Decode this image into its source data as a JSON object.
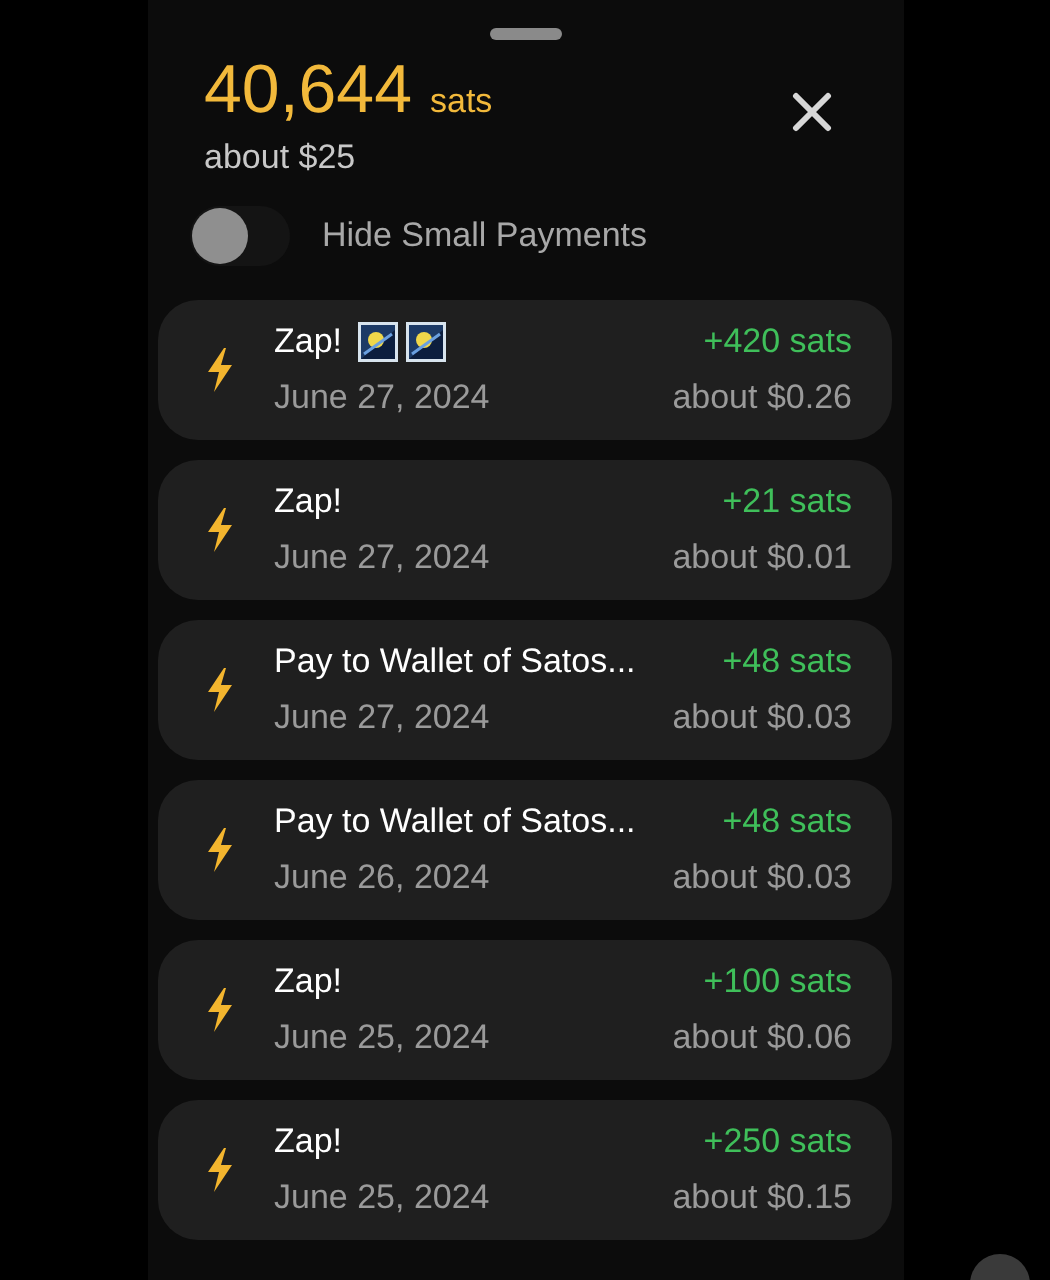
{
  "balance": {
    "amount": "40,644",
    "unit": "sats",
    "fiat": "about $25"
  },
  "toggle": {
    "label": "Hide Small Payments",
    "on": false
  },
  "payments": [
    {
      "title": "Zap!",
      "date": "June 27, 2024",
      "amount": "+420 sats",
      "fiat": "about $0.26"
    },
    {
      "title": "Zap!",
      "date": "June 27, 2024",
      "amount": "+21 sats",
      "fiat": "about $0.01"
    },
    {
      "title": "Pay to Wallet of Satos...",
      "date": "June 27, 2024",
      "amount": "+48 sats",
      "fiat": "about $0.03"
    },
    {
      "title": "Pay to Wallet of Satos...",
      "date": "June 26, 2024",
      "amount": "+48 sats",
      "fiat": "about $0.03"
    },
    {
      "title": "Zap!",
      "date": "June 25, 2024",
      "amount": "+100 sats",
      "fiat": "about $0.06"
    },
    {
      "title": "Zap!",
      "date": "June 25, 2024",
      "amount": "+250 sats",
      "fiat": "about $0.15"
    }
  ]
}
